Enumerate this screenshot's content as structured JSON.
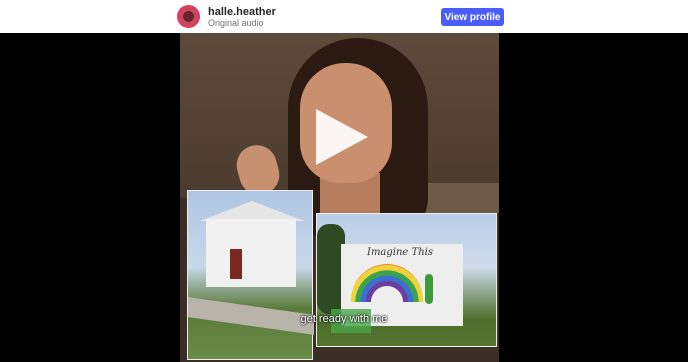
{
  "header": {
    "username": "halle.heather",
    "audio": "Original audio",
    "view_profile": "View profile"
  },
  "video": {
    "caption": "get ready with me",
    "mural_text": "Imagine This"
  },
  "colors": {
    "accent": "#4a5df9",
    "background": "#000000"
  },
  "icons": {
    "play": "play-icon"
  }
}
